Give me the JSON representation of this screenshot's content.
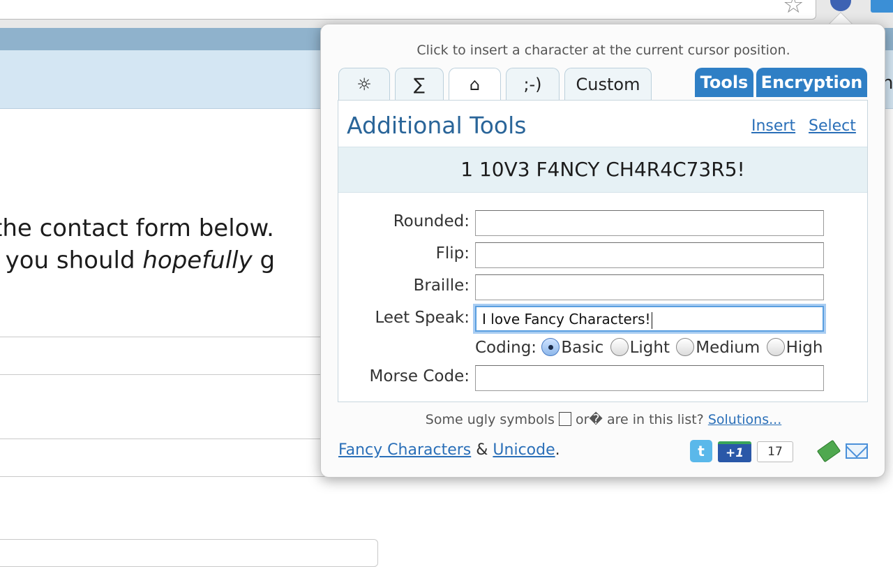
{
  "browser": {
    "toolbar_icons": [
      "star-icon",
      "extension-icon",
      "extension-icon-2"
    ]
  },
  "page": {
    "band_edge_text": "n",
    "text_line1": "the contact form below.",
    "text_line2_a": "o you should ",
    "text_line2_em": "hopefully",
    "text_line2_b": " g"
  },
  "popup": {
    "hint": "Click to insert a character at the current cursor position.",
    "tabs": [
      "☼",
      "∑",
      "⌂",
      ";-)",
      "Custom"
    ],
    "blue_tabs": [
      "Tools",
      "Encryption"
    ],
    "panel": {
      "title": "Additional Tools",
      "insert_link": "Insert",
      "select_link": "Select",
      "preview": "1 10V3 F4NCY CH4R4C73R5!",
      "fields": {
        "rounded_label": "Rounded:",
        "rounded_value": "",
        "flip_label": "Flip:",
        "flip_value": "",
        "braille_label": "Braille:",
        "braille_value": "",
        "leet_label": "Leet Speak:",
        "leet_value": "I love Fancy Characters!",
        "morse_label": "Morse Code:",
        "morse_value": ""
      },
      "coding": {
        "label": "Coding:",
        "options": [
          "Basic",
          "Light",
          "Medium",
          "High"
        ],
        "selected": "Basic"
      }
    },
    "notice": {
      "text_a": "Some ugly symbols",
      "text_b": "or",
      "glyph": "�",
      "text_c": "are in this list?",
      "link": "Solutions..."
    },
    "footer": {
      "link1": "Fancy Characters",
      "amp": "&",
      "link2": "Unicode",
      "period": ".",
      "twitter_glyph": "t",
      "plus_one": "+1",
      "count": "17"
    }
  },
  "colors": {
    "accent_blue": "#2f7fc5",
    "link_blue": "#2a6fb8",
    "title_blue": "#2a6599",
    "preview_bg": "#e6f1f5"
  }
}
